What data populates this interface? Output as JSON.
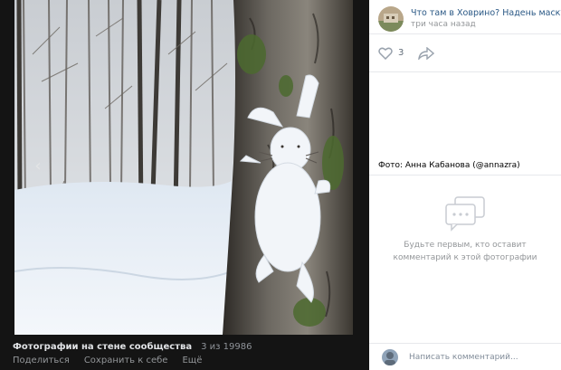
{
  "photo": {
    "album_title": "Фотографии на стене сообщества",
    "counter": "3 из 19986",
    "actions": {
      "share": "Поделиться",
      "save": "Сохранить к себе",
      "more": "Ещё"
    }
  },
  "sidebar": {
    "author_name": "Что там в Ховрино? Надень маску",
    "post_time": "три часа назад",
    "likes": "3",
    "caption": "Фото: Анна Кабанова (@annazra)",
    "empty_comments": "Будьте первым, кто оставит комментарий к этой фотографии",
    "comment_placeholder": "Написать комментарий..."
  },
  "icons": {
    "heart": "heart-icon",
    "share": "share-arrow-icon",
    "comments": "comment-bubble-icon",
    "prev": "chevron-left-icon",
    "next": "chevron-right-icon"
  },
  "colors": {
    "link": "#2a5885",
    "muted": "#939699",
    "viewer_bg": "#141414"
  }
}
